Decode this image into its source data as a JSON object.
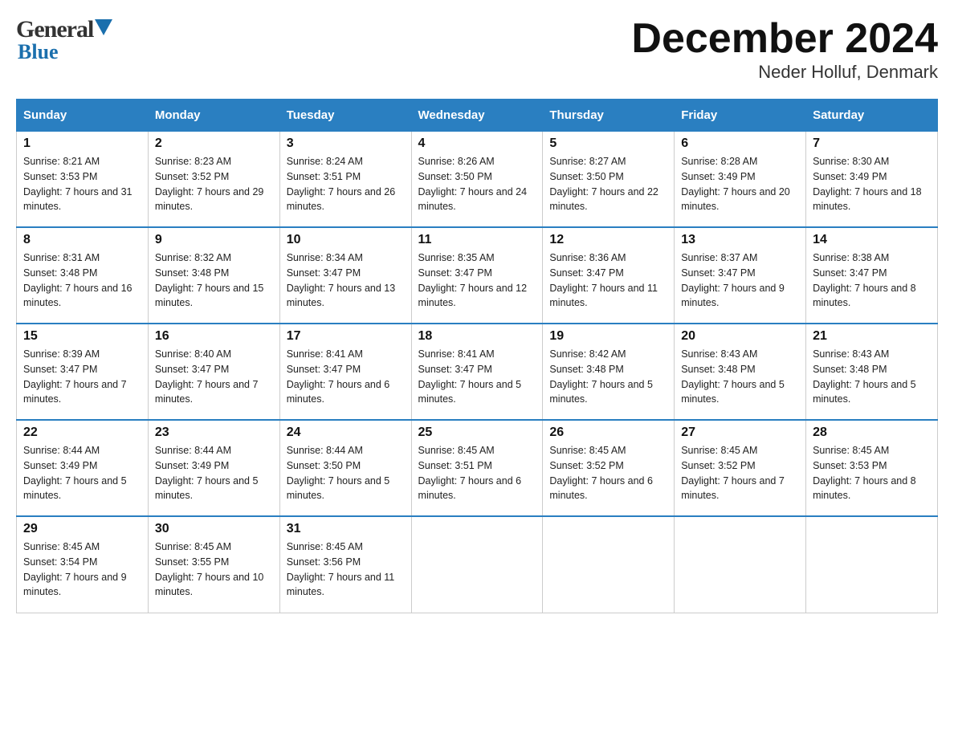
{
  "logo": {
    "general": "General",
    "blue": "Blue"
  },
  "header": {
    "title": "December 2024",
    "subtitle": "Neder Holluf, Denmark"
  },
  "days_of_week": [
    "Sunday",
    "Monday",
    "Tuesday",
    "Wednesday",
    "Thursday",
    "Friday",
    "Saturday"
  ],
  "weeks": [
    [
      {
        "day": "1",
        "sunrise": "8:21 AM",
        "sunset": "3:53 PM",
        "daylight": "7 hours and 31 minutes."
      },
      {
        "day": "2",
        "sunrise": "8:23 AM",
        "sunset": "3:52 PM",
        "daylight": "7 hours and 29 minutes."
      },
      {
        "day": "3",
        "sunrise": "8:24 AM",
        "sunset": "3:51 PM",
        "daylight": "7 hours and 26 minutes."
      },
      {
        "day": "4",
        "sunrise": "8:26 AM",
        "sunset": "3:50 PM",
        "daylight": "7 hours and 24 minutes."
      },
      {
        "day": "5",
        "sunrise": "8:27 AM",
        "sunset": "3:50 PM",
        "daylight": "7 hours and 22 minutes."
      },
      {
        "day": "6",
        "sunrise": "8:28 AM",
        "sunset": "3:49 PM",
        "daylight": "7 hours and 20 minutes."
      },
      {
        "day": "7",
        "sunrise": "8:30 AM",
        "sunset": "3:49 PM",
        "daylight": "7 hours and 18 minutes."
      }
    ],
    [
      {
        "day": "8",
        "sunrise": "8:31 AM",
        "sunset": "3:48 PM",
        "daylight": "7 hours and 16 minutes."
      },
      {
        "day": "9",
        "sunrise": "8:32 AM",
        "sunset": "3:48 PM",
        "daylight": "7 hours and 15 minutes."
      },
      {
        "day": "10",
        "sunrise": "8:34 AM",
        "sunset": "3:47 PM",
        "daylight": "7 hours and 13 minutes."
      },
      {
        "day": "11",
        "sunrise": "8:35 AM",
        "sunset": "3:47 PM",
        "daylight": "7 hours and 12 minutes."
      },
      {
        "day": "12",
        "sunrise": "8:36 AM",
        "sunset": "3:47 PM",
        "daylight": "7 hours and 11 minutes."
      },
      {
        "day": "13",
        "sunrise": "8:37 AM",
        "sunset": "3:47 PM",
        "daylight": "7 hours and 9 minutes."
      },
      {
        "day": "14",
        "sunrise": "8:38 AM",
        "sunset": "3:47 PM",
        "daylight": "7 hours and 8 minutes."
      }
    ],
    [
      {
        "day": "15",
        "sunrise": "8:39 AM",
        "sunset": "3:47 PM",
        "daylight": "7 hours and 7 minutes."
      },
      {
        "day": "16",
        "sunrise": "8:40 AM",
        "sunset": "3:47 PM",
        "daylight": "7 hours and 7 minutes."
      },
      {
        "day": "17",
        "sunrise": "8:41 AM",
        "sunset": "3:47 PM",
        "daylight": "7 hours and 6 minutes."
      },
      {
        "day": "18",
        "sunrise": "8:41 AM",
        "sunset": "3:47 PM",
        "daylight": "7 hours and 5 minutes."
      },
      {
        "day": "19",
        "sunrise": "8:42 AM",
        "sunset": "3:48 PM",
        "daylight": "7 hours and 5 minutes."
      },
      {
        "day": "20",
        "sunrise": "8:43 AM",
        "sunset": "3:48 PM",
        "daylight": "7 hours and 5 minutes."
      },
      {
        "day": "21",
        "sunrise": "8:43 AM",
        "sunset": "3:48 PM",
        "daylight": "7 hours and 5 minutes."
      }
    ],
    [
      {
        "day": "22",
        "sunrise": "8:44 AM",
        "sunset": "3:49 PM",
        "daylight": "7 hours and 5 minutes."
      },
      {
        "day": "23",
        "sunrise": "8:44 AM",
        "sunset": "3:49 PM",
        "daylight": "7 hours and 5 minutes."
      },
      {
        "day": "24",
        "sunrise": "8:44 AM",
        "sunset": "3:50 PM",
        "daylight": "7 hours and 5 minutes."
      },
      {
        "day": "25",
        "sunrise": "8:45 AM",
        "sunset": "3:51 PM",
        "daylight": "7 hours and 6 minutes."
      },
      {
        "day": "26",
        "sunrise": "8:45 AM",
        "sunset": "3:52 PM",
        "daylight": "7 hours and 6 minutes."
      },
      {
        "day": "27",
        "sunrise": "8:45 AM",
        "sunset": "3:52 PM",
        "daylight": "7 hours and 7 minutes."
      },
      {
        "day": "28",
        "sunrise": "8:45 AM",
        "sunset": "3:53 PM",
        "daylight": "7 hours and 8 minutes."
      }
    ],
    [
      {
        "day": "29",
        "sunrise": "8:45 AM",
        "sunset": "3:54 PM",
        "daylight": "7 hours and 9 minutes."
      },
      {
        "day": "30",
        "sunrise": "8:45 AM",
        "sunset": "3:55 PM",
        "daylight": "7 hours and 10 minutes."
      },
      {
        "day": "31",
        "sunrise": "8:45 AM",
        "sunset": "3:56 PM",
        "daylight": "7 hours and 11 minutes."
      },
      null,
      null,
      null,
      null
    ]
  ]
}
